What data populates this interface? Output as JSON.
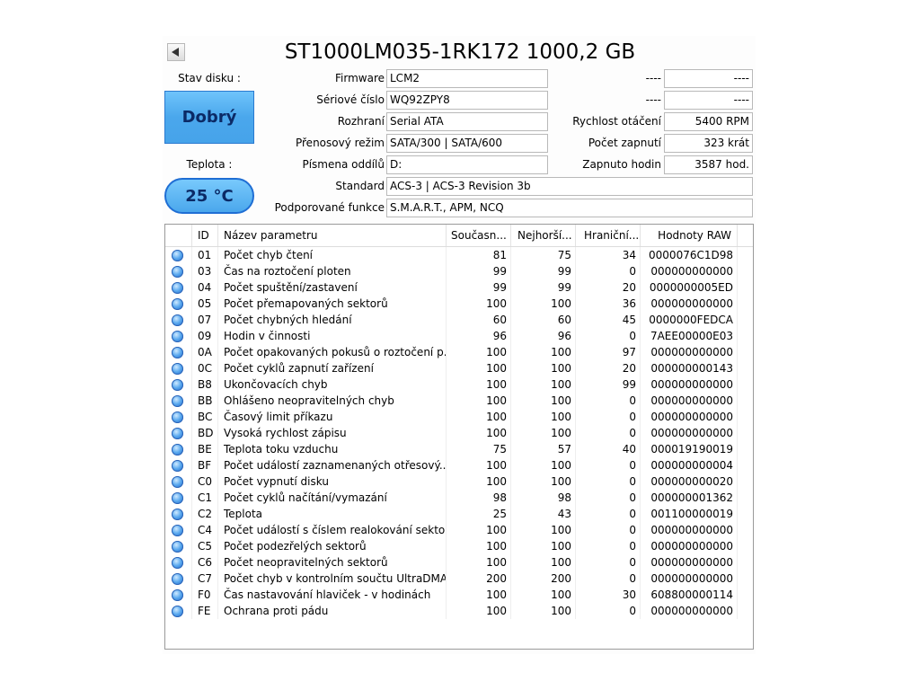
{
  "title": "ST1000LM035-1RK172 1000,2 GB",
  "left": {
    "health_label": "Stav disku :",
    "health_value": "Dobrý",
    "temp_label": "Teplota :",
    "temp_value": "25 °C",
    "colors": {
      "status_blue": "#4aa7ec",
      "status_border": "#2a7ad0"
    }
  },
  "info": {
    "firmware_label": "Firmware",
    "firmware": "LCM2",
    "serial_label": "Sériové číslo",
    "serial": "WQ92ZPY8",
    "interface_label": "Rozhraní",
    "interface": "Serial ATA",
    "transfer_label": "Přenosový režim",
    "transfer": "SATA/300 | SATA/600",
    "letters_label": "Písmena oddílů",
    "letters": "D:",
    "standard_label": "Standard",
    "standard": "ACS-3 | ACS-3 Revision 3b",
    "features_label": "Podporované funkce",
    "features": "S.M.A.R.T., APM, NCQ"
  },
  "right": {
    "blank1_label": "----",
    "blank1_value": "----",
    "blank2_label": "----",
    "blank2_value": "----",
    "rpm_label": "Rychlost otáčení",
    "rpm": "5400 RPM",
    "power_count_label": "Počet zapnutí",
    "power_count": "323 krát",
    "power_hours_label": "Zapnuto hodin",
    "power_hours": "3587 hod."
  },
  "smart": {
    "columns": [
      "ID",
      "Název parametru",
      "Současn...",
      "Nejhorší...",
      "Hraniční...",
      "Hodnoty RAW"
    ],
    "rows": [
      {
        "id": "01",
        "name": "Počet chyb čtení",
        "cur": "81",
        "worst": "75",
        "thr": "34",
        "raw": "0000076C1D98"
      },
      {
        "id": "03",
        "name": "Čas na roztočení ploten",
        "cur": "99",
        "worst": "99",
        "thr": "0",
        "raw": "000000000000"
      },
      {
        "id": "04",
        "name": "Počet spuštění/zastavení",
        "cur": "99",
        "worst": "99",
        "thr": "20",
        "raw": "0000000005ED"
      },
      {
        "id": "05",
        "name": "Počet přemapovaných sektorů",
        "cur": "100",
        "worst": "100",
        "thr": "36",
        "raw": "000000000000"
      },
      {
        "id": "07",
        "name": "Počet chybných hledání",
        "cur": "60",
        "worst": "60",
        "thr": "45",
        "raw": "0000000FEDCA"
      },
      {
        "id": "09",
        "name": "Hodin v činnosti",
        "cur": "96",
        "worst": "96",
        "thr": "0",
        "raw": "7AEE00000E03"
      },
      {
        "id": "0A",
        "name": "Počet opakovaných pokusů o roztočení p...",
        "cur": "100",
        "worst": "100",
        "thr": "97",
        "raw": "000000000000"
      },
      {
        "id": "0C",
        "name": "Počet cyklů zapnutí zařízení",
        "cur": "100",
        "worst": "100",
        "thr": "20",
        "raw": "000000000143"
      },
      {
        "id": "B8",
        "name": "Ukončovacích chyb",
        "cur": "100",
        "worst": "100",
        "thr": "99",
        "raw": "000000000000"
      },
      {
        "id": "BB",
        "name": "Ohlášeno neopravitelných chyb",
        "cur": "100",
        "worst": "100",
        "thr": "0",
        "raw": "000000000000"
      },
      {
        "id": "BC",
        "name": "Časový limit příkazu",
        "cur": "100",
        "worst": "100",
        "thr": "0",
        "raw": "000000000000"
      },
      {
        "id": "BD",
        "name": "Vysoká rychlost zápisu",
        "cur": "100",
        "worst": "100",
        "thr": "0",
        "raw": "000000000000"
      },
      {
        "id": "BE",
        "name": "Teplota toku vzduchu",
        "cur": "75",
        "worst": "57",
        "thr": "40",
        "raw": "000019190019"
      },
      {
        "id": "BF",
        "name": "Počet událostí zaznamenaných otřesový...",
        "cur": "100",
        "worst": "100",
        "thr": "0",
        "raw": "000000000004"
      },
      {
        "id": "C0",
        "name": "Počet vypnutí disku",
        "cur": "100",
        "worst": "100",
        "thr": "0",
        "raw": "000000000020"
      },
      {
        "id": "C1",
        "name": "Počet cyklů načítání/vymazání",
        "cur": "98",
        "worst": "98",
        "thr": "0",
        "raw": "000000001362"
      },
      {
        "id": "C2",
        "name": "Teplota",
        "cur": "25",
        "worst": "43",
        "thr": "0",
        "raw": "001100000019"
      },
      {
        "id": "C4",
        "name": "Počet událostí s číslem realokování sektorů",
        "cur": "100",
        "worst": "100",
        "thr": "0",
        "raw": "000000000000"
      },
      {
        "id": "C5",
        "name": "Počet podezřelých sektorů",
        "cur": "100",
        "worst": "100",
        "thr": "0",
        "raw": "000000000000"
      },
      {
        "id": "C6",
        "name": "Počet neopravitelných sektorů",
        "cur": "100",
        "worst": "100",
        "thr": "0",
        "raw": "000000000000"
      },
      {
        "id": "C7",
        "name": "Počet chyb v kontrolním součtu UltraDMA",
        "cur": "200",
        "worst": "200",
        "thr": "0",
        "raw": "000000000000"
      },
      {
        "id": "F0",
        "name": "Čas nastavování hlaviček - v hodinách",
        "cur": "100",
        "worst": "100",
        "thr": "30",
        "raw": "608800000114"
      },
      {
        "id": "FE",
        "name": "Ochrana proti pádu",
        "cur": "100",
        "worst": "100",
        "thr": "0",
        "raw": "000000000000"
      }
    ]
  }
}
